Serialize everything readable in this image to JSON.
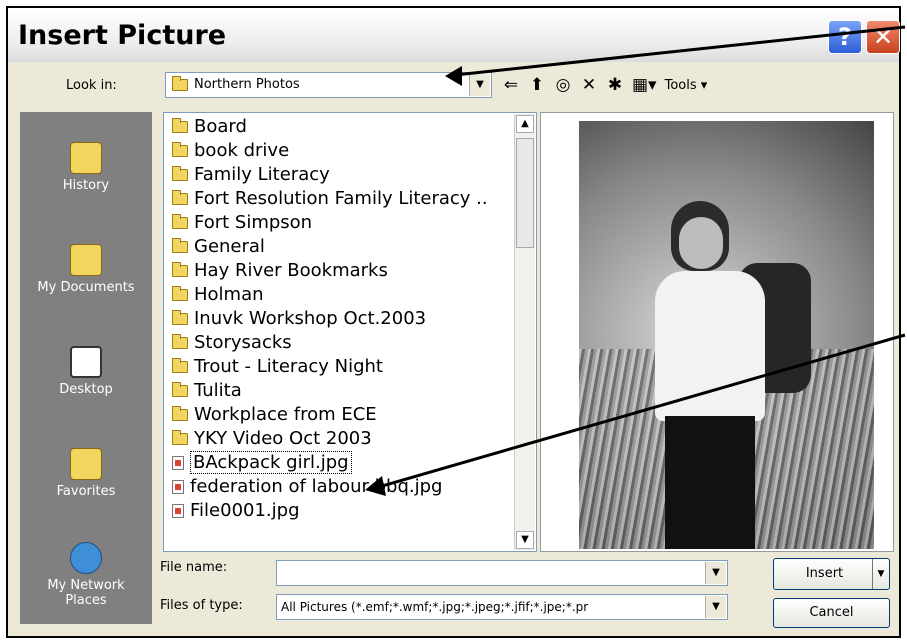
{
  "dialog": {
    "title": "Insert Picture",
    "help_glyph": "?",
    "close_glyph": "✕"
  },
  "lookin": {
    "label": "Look in:",
    "value": "Northern Photos"
  },
  "toolbar": {
    "tools_label": "Tools ▾"
  },
  "places": [
    {
      "label": "History",
      "icon": "history-icon"
    },
    {
      "label": "My Documents",
      "icon": "my-documents-icon"
    },
    {
      "label": "Desktop",
      "icon": "desktop-icon"
    },
    {
      "label": "Favorites",
      "icon": "favorites-icon"
    },
    {
      "label": "My Network Places",
      "icon": "network-places-icon"
    }
  ],
  "files": [
    {
      "name": "Board",
      "type": "folder"
    },
    {
      "name": "book drive",
      "type": "folder"
    },
    {
      "name": "Family Literacy",
      "type": "folder"
    },
    {
      "name": "Fort Resolution Family Literacy ..",
      "type": "folder"
    },
    {
      "name": "Fort Simpson",
      "type": "folder"
    },
    {
      "name": "General",
      "type": "folder"
    },
    {
      "name": "Hay River Bookmarks",
      "type": "folder"
    },
    {
      "name": "Holman",
      "type": "folder"
    },
    {
      "name": "Inuvk Workshop Oct.2003",
      "type": "folder"
    },
    {
      "name": "Storysacks",
      "type": "folder"
    },
    {
      "name": "Trout - Literacy Night",
      "type": "folder"
    },
    {
      "name": "Tulita",
      "type": "folder"
    },
    {
      "name": "Workplace from ECE",
      "type": "folder"
    },
    {
      "name": "YKY Video Oct 2003",
      "type": "folder"
    },
    {
      "name": "BAckpack girl.jpg",
      "type": "file",
      "selected": true
    },
    {
      "name": "federation of labour bbq.jpg",
      "type": "file"
    },
    {
      "name": "File0001.jpg",
      "type": "file"
    }
  ],
  "filename": {
    "label": "File name:",
    "value": ""
  },
  "filetype": {
    "label": "Files of type:",
    "value": "All Pictures (*.emf;*.wmf;*.jpg;*.jpeg;*.jfif;*.jpe;*.pr"
  },
  "buttons": {
    "insert": "Insert",
    "cancel": "Cancel"
  },
  "colors": {
    "places_bg": "#808080",
    "dialog_bg": "#ece9d8",
    "close_red": "#c8411d",
    "help_blue": "#2d5fd6"
  }
}
